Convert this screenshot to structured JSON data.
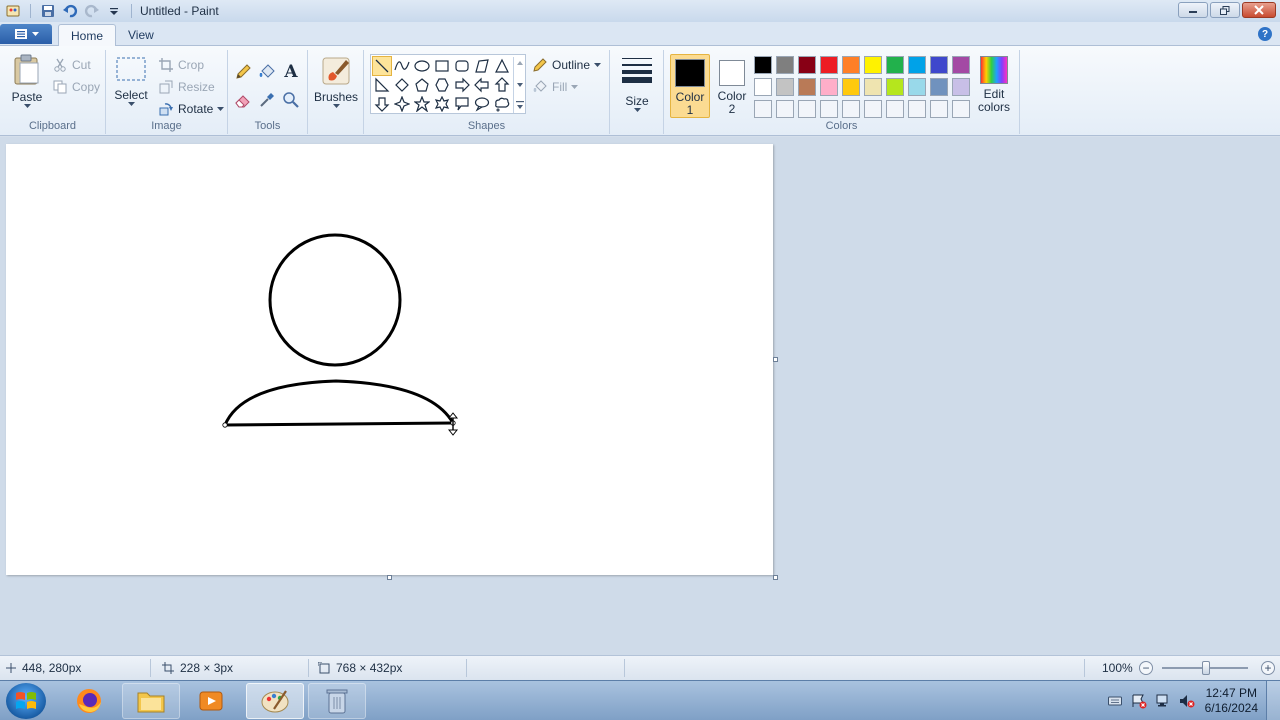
{
  "window": {
    "title": "Untitled - Paint"
  },
  "tabs": {
    "home": "Home",
    "view": "View"
  },
  "ribbon": {
    "clipboard": {
      "label": "Clipboard",
      "paste": "Paste",
      "cut": "Cut",
      "copy": "Copy"
    },
    "image": {
      "label": "Image",
      "select": "Select",
      "crop": "Crop",
      "resize": "Resize",
      "rotate": "Rotate"
    },
    "tools": {
      "label": "Tools",
      "text_glyph": "A"
    },
    "brushes": {
      "label": "Brushes"
    },
    "shapes": {
      "label": "Shapes",
      "outline": "Outline",
      "fill": "Fill"
    },
    "size": {
      "label": "Size"
    },
    "colors": {
      "label": "Colors",
      "color1_line1": "Color",
      "color1_line2": "1",
      "color2_line1": "Color",
      "color2_line2": "2",
      "edit_line1": "Edit",
      "edit_line2": "colors",
      "color1_value": "#000000",
      "color2_value": "#ffffff",
      "palette_row1": [
        "#000000",
        "#7f7f7f",
        "#880015",
        "#ed1c24",
        "#ff7f27",
        "#fff200",
        "#22b14c",
        "#00a2e8",
        "#3f48cc",
        "#a349a4"
      ],
      "palette_row2": [
        "#ffffff",
        "#c3c3c3",
        "#b97a57",
        "#ffaec9",
        "#ffc90e",
        "#efe4b0",
        "#b5e61d",
        "#99d9ea",
        "#7092be",
        "#c8bfe7"
      ],
      "palette_row3": [
        "#f2f5fa",
        "#f2f5fa",
        "#f2f5fa",
        "#f2f5fa",
        "#f2f5fa",
        "#f2f5fa",
        "#f2f5fa",
        "#f2f5fa",
        "#f2f5fa",
        "#f2f5fa"
      ]
    }
  },
  "status": {
    "cursor_pos": "448, 280px",
    "selection_size": "228 × 3px",
    "canvas_size": "768 × 432px",
    "zoom": "100%",
    "zoom_minus": "−",
    "zoom_plus": "+"
  },
  "taskbar": {
    "time": "12:47 PM",
    "date": "6/16/2024"
  }
}
